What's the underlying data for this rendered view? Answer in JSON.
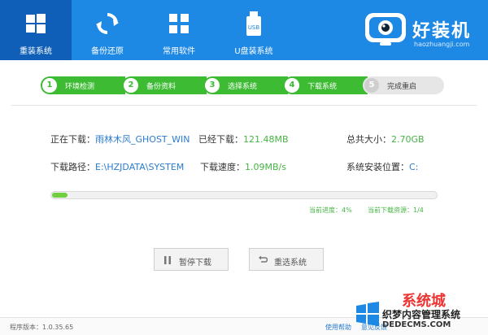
{
  "nav": {
    "tabs": [
      {
        "label": "重装系统",
        "icon": "windows-icon",
        "active": true
      },
      {
        "label": "备份还原",
        "icon": "refresh-icon",
        "active": false
      },
      {
        "label": "常用软件",
        "icon": "apps-grid-icon",
        "active": false
      },
      {
        "label": "U盘装系统",
        "icon": "usb-icon",
        "active": false
      }
    ],
    "usb_text": "USB"
  },
  "brand": {
    "name": "好装机",
    "url": "haozhuangji.com",
    "icon": "tv-logo-icon"
  },
  "steps": [
    {
      "num": "1",
      "label": "环境检测"
    },
    {
      "num": "2",
      "label": "备份资料"
    },
    {
      "num": "3",
      "label": "选择系统"
    },
    {
      "num": "4",
      "label": "下载系统"
    },
    {
      "num": "5",
      "label": "完成重启"
    }
  ],
  "info": {
    "downloading_label": "正在下载：",
    "downloading_value": "雨林木风_GHOST_WIN",
    "downloaded_label": "已经下载：",
    "downloaded_value": "121.48MB",
    "total_label": "总共大小：",
    "total_value": "2.70GB",
    "path_label": "下载路径：",
    "path_value": "E:\\HZJDATA\\SYSTEM",
    "speed_label": "下载速度：",
    "speed_value": "1.09MB/s",
    "install_label": "系统安装位置：",
    "install_value": "C:"
  },
  "progress": {
    "fraction": 0.04,
    "current_label": "当前进度：",
    "current_value": "4%",
    "resource_label": "当前下载资源：",
    "resource_value": "1/4"
  },
  "buttons": {
    "pause": "暂停下载",
    "reselect": "重选系统"
  },
  "footer": {
    "version": "程序版本：1.0.35.65",
    "help": "使用帮助",
    "feedback": "意见反馈"
  },
  "watermark": {
    "line0": "系统城",
    "line1": "织梦内容管理系统",
    "line2": "DEDECMS.COM"
  },
  "colors": {
    "header": "#1e88e5",
    "active_tab": "#0f5fb9",
    "step_green": "#3cbb33",
    "value_green": "#44b544",
    "link_blue": "#2a7ccf"
  }
}
